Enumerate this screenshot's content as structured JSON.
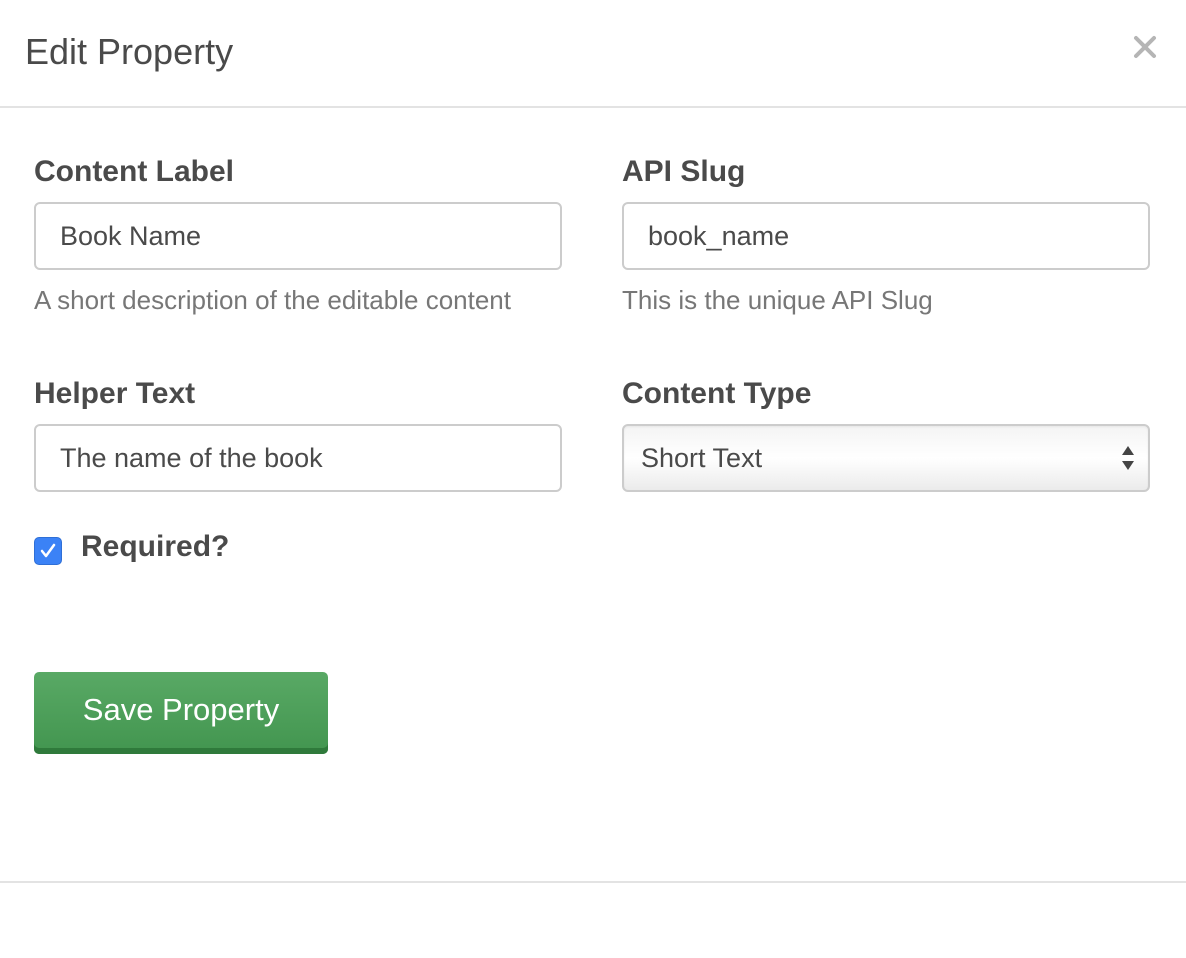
{
  "dialog": {
    "title": "Edit Property",
    "close_icon": "close-icon"
  },
  "form": {
    "content_label": {
      "label": "Content Label",
      "value": "Book Name",
      "help": "A short description of the editable content"
    },
    "api_slug": {
      "label": "API Slug",
      "value": "book_name",
      "help": "This is the unique API Slug"
    },
    "helper_text": {
      "label": "Helper Text",
      "value": "The name of the book"
    },
    "content_type": {
      "label": "Content Type",
      "selected": "Short Text",
      "arrow_icon": "select-arrows-icon"
    },
    "required": {
      "label": "Required?",
      "checked": true,
      "check_color": "#3b82f6"
    },
    "save_label": "Save Property"
  },
  "colors": {
    "save_button": "#4a9b56",
    "checkbox": "#3b82f6",
    "text": "#4a4a4a",
    "help_text": "#777777",
    "border": "#cccccc"
  }
}
